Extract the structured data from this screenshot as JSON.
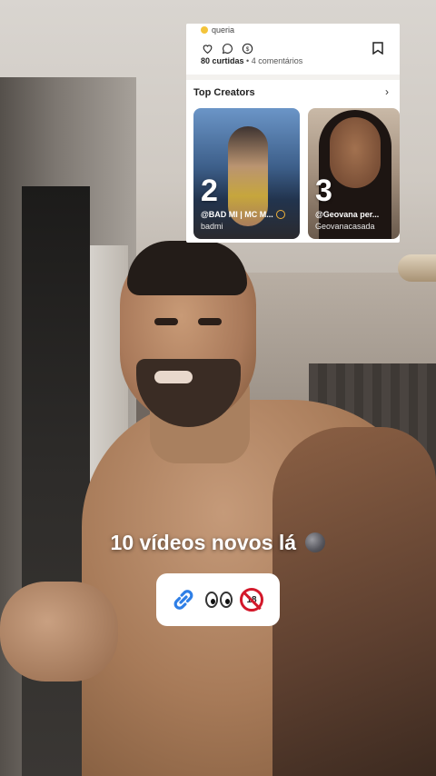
{
  "post_card": {
    "caption": "queria",
    "likes_count": "80 curtidas",
    "separator": "•",
    "comments_count": "4 comentários",
    "icons": [
      "heart-icon",
      "comment-icon",
      "dollar-icon",
      "bookmark-icon"
    ]
  },
  "top_creators": {
    "title": "Top Creators",
    "chevron": "›",
    "items": [
      {
        "rank": "2",
        "handle": "@BAD MI | MC M...",
        "username": "badmi",
        "verified": true
      },
      {
        "rank": "3",
        "handle": "@Geovana per...",
        "username": "Geovanacasada",
        "verified": false
      }
    ]
  },
  "overlay": {
    "text": "10 vídeos novos lá",
    "emoji": "new-moon-face"
  },
  "link_sticker": {
    "icons": [
      "link-icon",
      "eyes-icon",
      "no-under-18-icon"
    ],
    "no18_label": "18"
  }
}
